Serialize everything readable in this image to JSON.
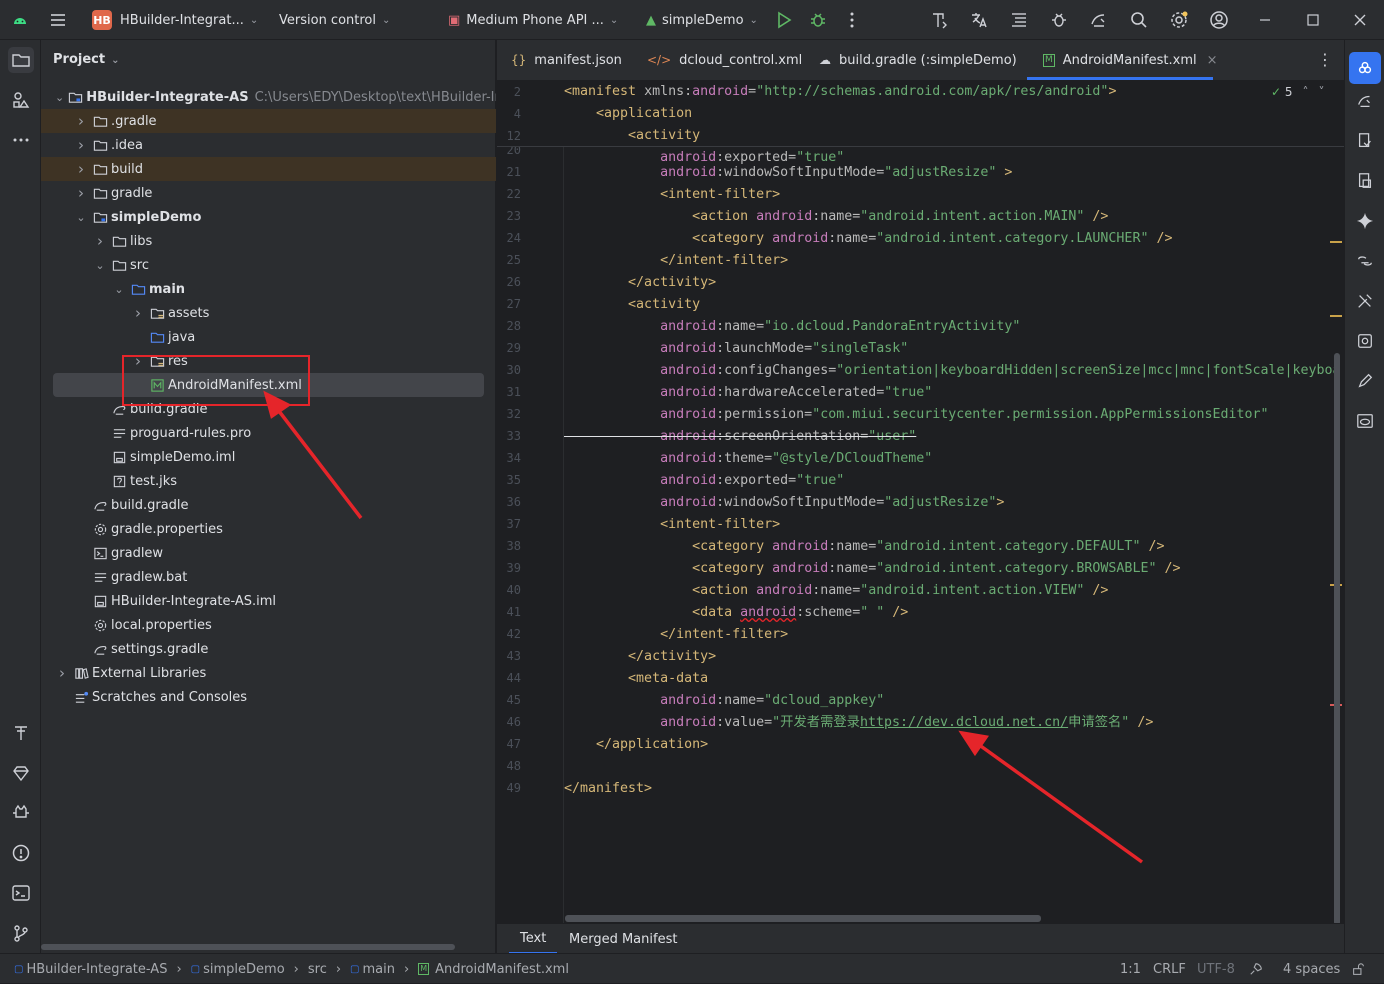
{
  "titlebar": {
    "project_badge": "HB",
    "project_name": "HBuilder-Integrat...",
    "vcs": "Version control",
    "device": "Medium Phone API ...",
    "run_config": "simpleDemo"
  },
  "project_panel": {
    "title": "Project",
    "root_name": "HBuilder-Integrate-AS",
    "root_path": "C:\\Users\\EDY\\Desktop\\text\\HBuilder-Integrat",
    "items": [
      {
        "label": ".gradle",
        "icon": "folder-icon"
      },
      {
        "label": ".idea",
        "icon": "folder-icon"
      },
      {
        "label": "build",
        "icon": "folder-icon"
      },
      {
        "label": "gradle",
        "icon": "folder-icon"
      },
      {
        "label": "simpleDemo",
        "icon": "module-folder-icon"
      },
      {
        "label": "libs",
        "icon": "folder-icon"
      },
      {
        "label": "src",
        "icon": "folder-icon"
      },
      {
        "label": "main",
        "icon": "source-folder-icon"
      },
      {
        "label": "assets",
        "icon": "resource-folder-icon"
      },
      {
        "label": "java",
        "icon": "source-folder-icon"
      },
      {
        "label": "res",
        "icon": "resource-folder-icon"
      },
      {
        "label": "AndroidManifest.xml",
        "icon": "manifest-icon"
      },
      {
        "label": "build.gradle",
        "icon": "gradle-icon"
      },
      {
        "label": "proguard-rules.pro",
        "icon": "text-file-icon"
      },
      {
        "label": "simpleDemo.iml",
        "icon": "iml-file-icon"
      },
      {
        "label": "test.jks",
        "icon": "keystore-icon"
      },
      {
        "label": "build.gradle",
        "icon": "gradle-icon"
      },
      {
        "label": "gradle.properties",
        "icon": "settings-file-icon"
      },
      {
        "label": "gradlew",
        "icon": "terminal-file-icon"
      },
      {
        "label": "gradlew.bat",
        "icon": "text-file-icon"
      },
      {
        "label": "HBuilder-Integrate-AS.iml",
        "icon": "iml-file-icon"
      },
      {
        "label": "local.properties",
        "icon": "settings-file-icon"
      },
      {
        "label": "settings.gradle",
        "icon": "gradle-icon"
      },
      {
        "label": "External Libraries",
        "icon": "library-icon"
      },
      {
        "label": "Scratches and Consoles",
        "icon": "scratches-icon"
      }
    ]
  },
  "tabs": [
    {
      "label": "manifest.json",
      "icon": "json-icon"
    },
    {
      "label": "dcloud_control.xml",
      "icon": "xml-icon"
    },
    {
      "label": "build.gradle (:simpleDemo)",
      "icon": "gradle-icon"
    },
    {
      "label": "AndroidManifest.xml",
      "icon": "manifest-icon",
      "active": true
    }
  ],
  "editor": {
    "inspection_count": "5",
    "sticky_numbers": [
      "2",
      "4",
      "12"
    ],
    "line_numbers": [
      "20",
      "21",
      "22",
      "23",
      "24",
      "25",
      "26",
      "27",
      "28",
      "29",
      "30",
      "31",
      "32",
      "33",
      "34",
      "35",
      "36",
      "37",
      "38",
      "39",
      "40",
      "41",
      "42",
      "43",
      "44",
      "45",
      "46",
      "47",
      "48",
      "49"
    ]
  },
  "bottom_tabs": [
    "Text",
    "Merged Manifest"
  ],
  "status": {
    "breadcrumb": [
      "HBuilder-Integrate-AS",
      "simpleDemo",
      "src",
      "main",
      "AndroidManifest.xml"
    ],
    "position": "1:1",
    "line_ending": "CRLF",
    "encoding": "UTF-8",
    "indent": "4 spaces"
  },
  "colors": {
    "accent": "#3574f0",
    "annotation": "#e5252a",
    "xml_tag": "#d5b778",
    "xml_ns": "#c77dbb",
    "xml_string": "#6aab73"
  }
}
